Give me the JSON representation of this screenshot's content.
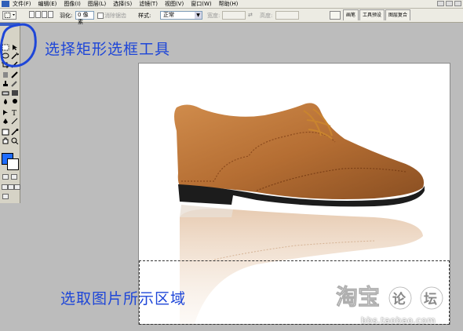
{
  "menubar": {
    "items": [
      "文件(F)",
      "编辑(E)",
      "图像(I)",
      "图层(L)",
      "选择(S)",
      "滤镜(T)",
      "视图(V)",
      "窗口(W)",
      "帮助(H)"
    ]
  },
  "options_bar": {
    "feather_label": "羽化:",
    "feather_value": "0 像素",
    "antialias_label": "消除锯齿",
    "style_label": "样式:",
    "style_value": "正常",
    "width_label": "宽度:",
    "height_label": "高度:"
  },
  "palette_tabs": [
    "画笔",
    "工具预设",
    "图层复合"
  ],
  "annotations": {
    "top": "选择矩形选框工具",
    "bottom": "选取图片所示区域"
  },
  "watermark": {
    "url": "bbs.taobao.com"
  },
  "colors": {
    "foreground": "#1e6cff",
    "background": "#ffffff",
    "annotation": "#1e46d8"
  }
}
